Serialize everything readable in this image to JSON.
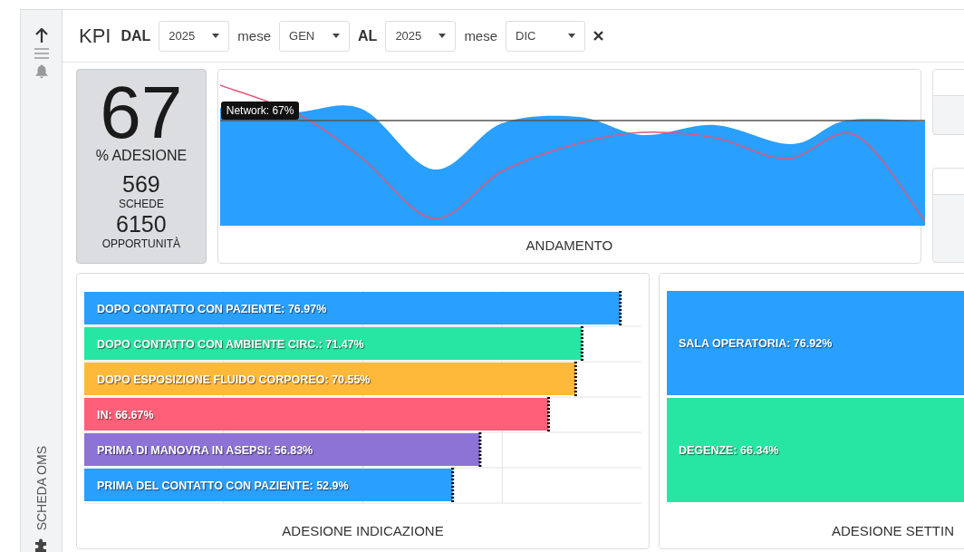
{
  "sidebar": {
    "label": "SCHEDA OMS"
  },
  "filters": {
    "title": "KPI",
    "from_label": "DAL",
    "from_year": "2025",
    "from_month_label": "mese",
    "from_month": "GEN",
    "to_label": "AL",
    "to_year": "2025",
    "to_month_label": "mese",
    "to_month": "DIC"
  },
  "summary": {
    "percentage": "67",
    "percentage_label": "% ADESIONE",
    "forms": "569",
    "forms_label": "SCHEDE",
    "opportunities": "6150",
    "opportunities_label": "OPPORTUNITÀ"
  },
  "trend": {
    "title": "ANDAMENTO",
    "tooltip": "Network: 67%"
  },
  "indication_chart": {
    "chart_data": {
      "type": "bar",
      "orientation": "horizontal",
      "title": "ADESIONE INDICAZIONE",
      "data_labels": true,
      "values": [
        76.97,
        71.47,
        70.55,
        66.67,
        56.83,
        52.9
      ],
      "value_labels": [
        "DOPO CONTATTO CON PAZIENTE: 76.97%",
        "DOPO CONTATTO CON AMBIENTE CIRC.: 71.47%",
        "DOPO ESPOSIZIONE FLUIDO CORPOREO: 70.55%",
        "IN: 66.67%",
        "PRIMA DI MANOVRA IN ASEPSI: 56.83%",
        "PRIMA DEL CONTATTO CON PAZIENTE: 52.9%"
      ],
      "colors": [
        "#299ffe",
        "#27e6a3",
        "#feb93b",
        "#fe6079",
        "#8c73d5",
        "#299ffe"
      ]
    }
  },
  "setting_chart": {
    "title": "ADESIONE SETTIN",
    "bars": [
      {
        "label": "SALA OPERATORIA: 76.92%",
        "color": "#299ffe"
      },
      {
        "label": "DEGENZE: 66.34%",
        "color": "#27e6a3"
      }
    ]
  }
}
